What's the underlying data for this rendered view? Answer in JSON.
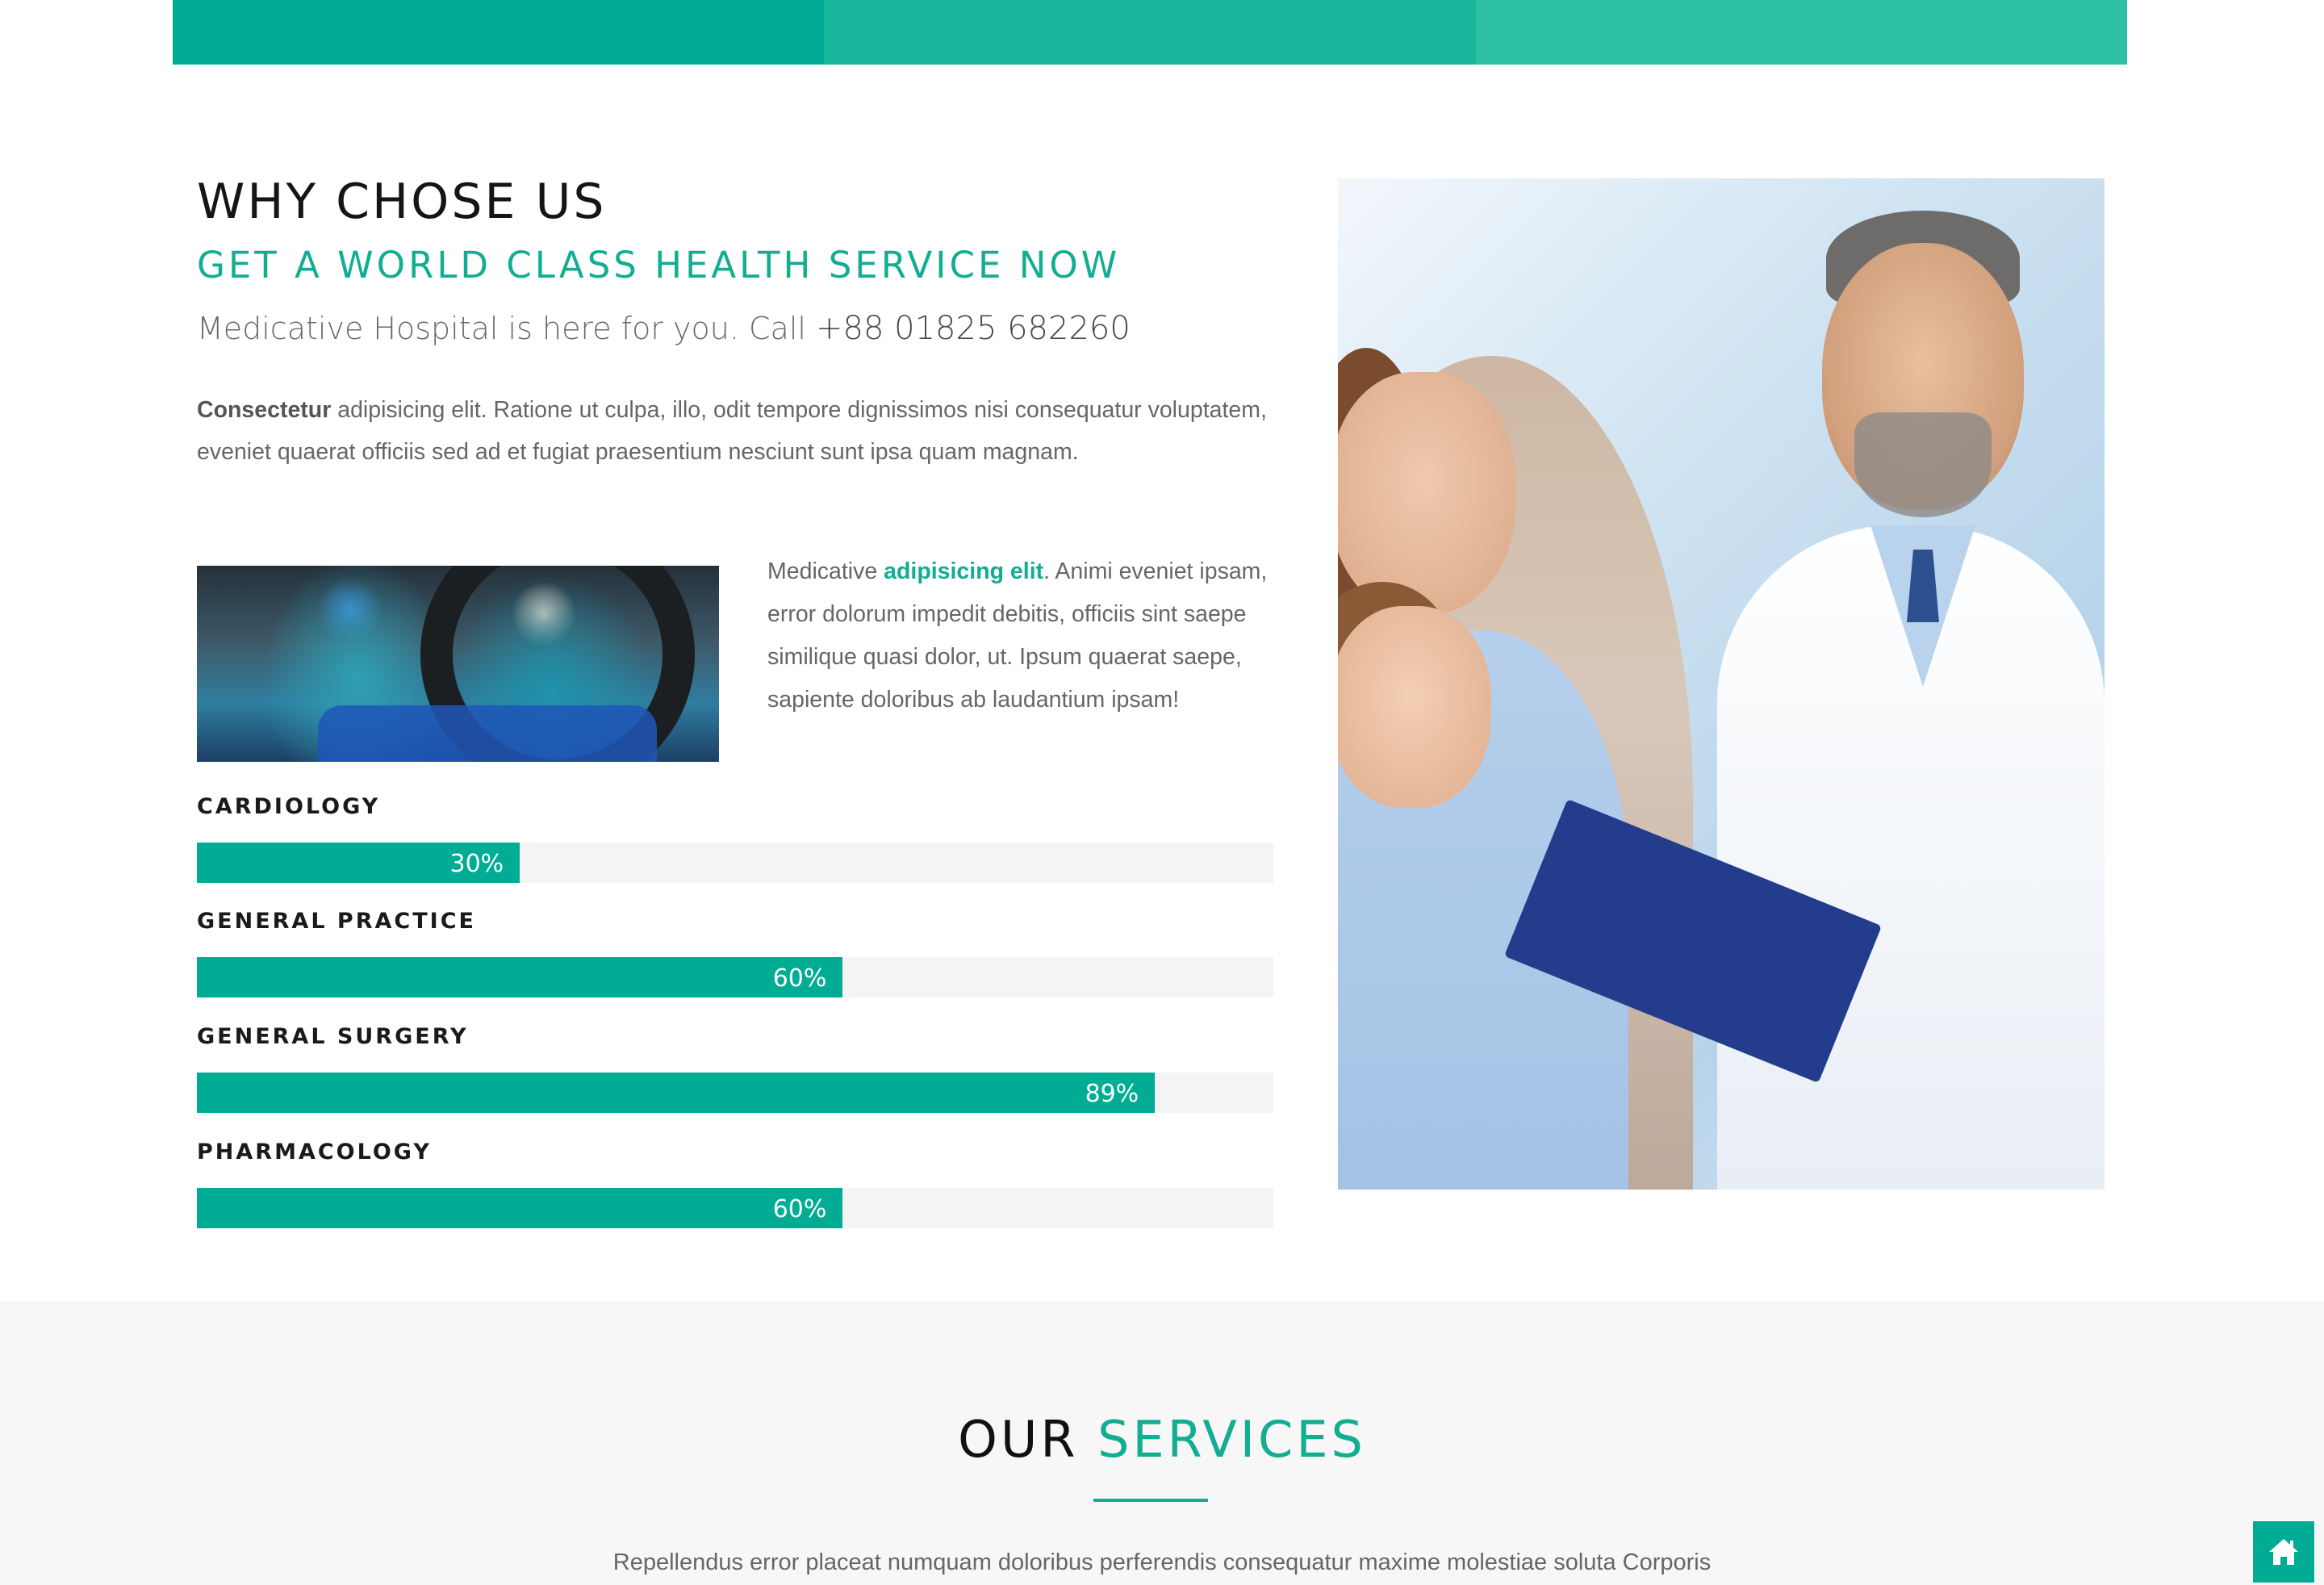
{
  "why": {
    "title": "WHY CHOSE US",
    "subtitle": "GET A WORLD CLASS HEALTH SERVICE NOW",
    "call_text": "Medicative Hospital is here for you. Call ",
    "phone": "+88 01825 682260",
    "intro_bold": "Consectetur",
    "intro_rest": " adipisicing elit. Ratione ut culpa, illo, odit tempore dignissimos nisi consequatur voluptatem, eveniet quaerat officiis sed ad et fugiat praesentium nesciunt sunt ipsa quam magnam.",
    "side_pre": "Medicative ",
    "side_highlight": "adipisicing elit",
    "side_post": ". Animi eveniet ipsam, error dolorum impedit debitis, officiis sint saepe similique quasi dolor, ut. Ipsum quaerat saepe, sapiente doloribus ab laudantium ipsam!"
  },
  "skills": [
    {
      "label": "CARDIOLOGY",
      "percent": 30,
      "percent_text": "30%"
    },
    {
      "label": "GENERAL PRACTICE",
      "percent": 60,
      "percent_text": "60%"
    },
    {
      "label": "GENERAL SURGERY",
      "percent": 89,
      "percent_text": "89%"
    },
    {
      "label": "PHARMACOLOGY",
      "percent": 60,
      "percent_text": "60%"
    }
  ],
  "services": {
    "title_plain": "OUR ",
    "title_accent": "SERVICES",
    "description": "Repellendus error placeat numquam doloribus perferendis consequatur maxime molestiae soluta Corporis"
  },
  "icons": {
    "home_button": "home-icon"
  },
  "colors": {
    "accent": "#00ad94",
    "accent_text": "#12ad92",
    "topbar": [
      "#00ad94",
      "#19b79c",
      "#2fc1a6"
    ],
    "track": "#f4f4f4",
    "services_bg": "#f7f7f7"
  }
}
